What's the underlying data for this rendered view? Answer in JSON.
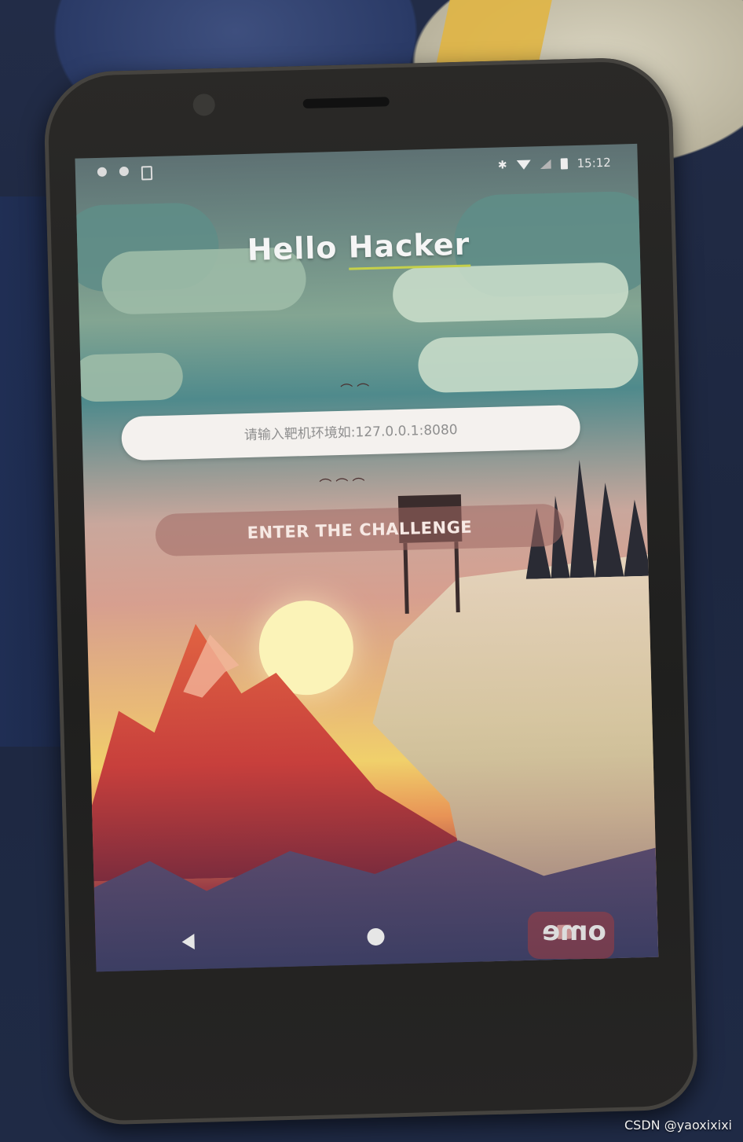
{
  "status_bar": {
    "time": "15:12"
  },
  "app": {
    "title": "Hello Hacker",
    "address_input": {
      "placeholder": "请输入靶机环境如:127.0.0.1:8080"
    },
    "enter_button_label": "ENTER THE CHALLENGE"
  },
  "phone_sticker_text": "ome",
  "watermark": "CSDN @yaoxixixi",
  "colors": {
    "input_bg": "#f4f1ee",
    "button_bg": "#a06964",
    "title_underline": "#c5d04a"
  }
}
